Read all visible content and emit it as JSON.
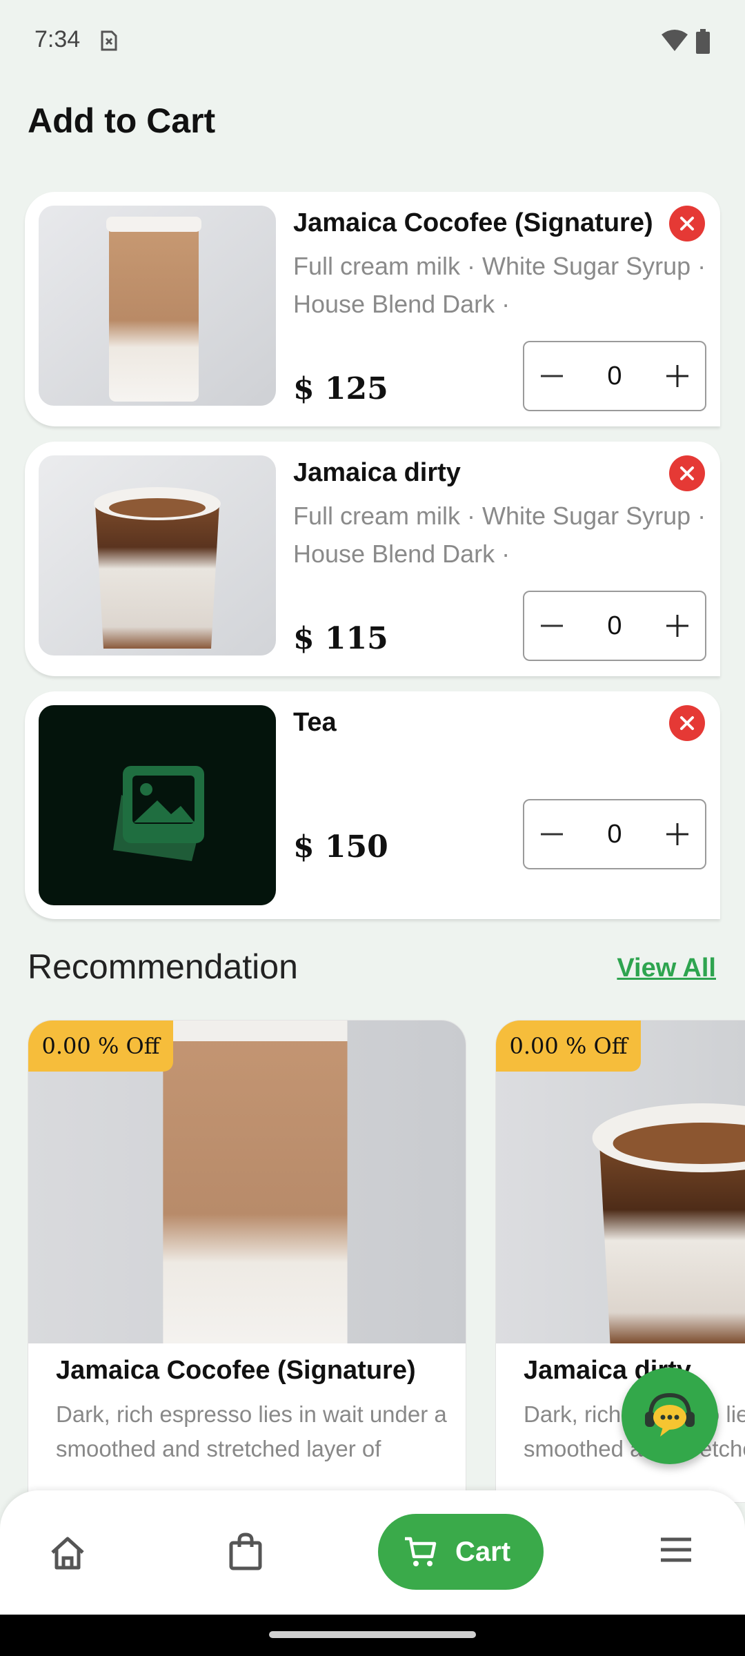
{
  "status_bar": {
    "time": "7:34",
    "icons": [
      "sim-card-icon",
      "wifi-icon",
      "battery-icon"
    ]
  },
  "page": {
    "title": "Add to Cart"
  },
  "cart_items": [
    {
      "name": "Jamaica Cocofee (Signature)",
      "options": "Full cream milk · White Sugar Syrup · House Blend Dark ·",
      "price": "$ 125",
      "quantity": "0",
      "image": "iced-latte-photo"
    },
    {
      "name": "Jamaica dirty",
      "options": "Full cream milk · White Sugar Syrup · House Blend Dark ·",
      "price": "$ 115",
      "quantity": "0",
      "image": "dirty-coffee-photo"
    },
    {
      "name": "Tea",
      "options": "",
      "price": "$ 150",
      "quantity": "0",
      "image": "image-placeholder-icon"
    }
  ],
  "recommendation": {
    "title": "Recommendation",
    "view_all_label": "View All",
    "items": [
      {
        "discount": "0.00 % Off",
        "name": "Jamaica Cocofee (Signature)",
        "description": "Dark, rich espresso lies in wait under a smoothed and stretched layer of"
      },
      {
        "discount": "0.00 % Off",
        "name": "Jamaica dirty",
        "description": "Dark, rich espresso lies in wait under a smoothed and stretched layer of"
      }
    ]
  },
  "bottom_nav": {
    "items": [
      "home",
      "orders",
      "Cart",
      "menu"
    ],
    "active_label": "Cart"
  },
  "colors": {
    "accent": "#3aaa4a",
    "remove": "#e53935",
    "badge": "#f6bd3b",
    "link": "#2ea44f",
    "background": "#eef3ef"
  }
}
